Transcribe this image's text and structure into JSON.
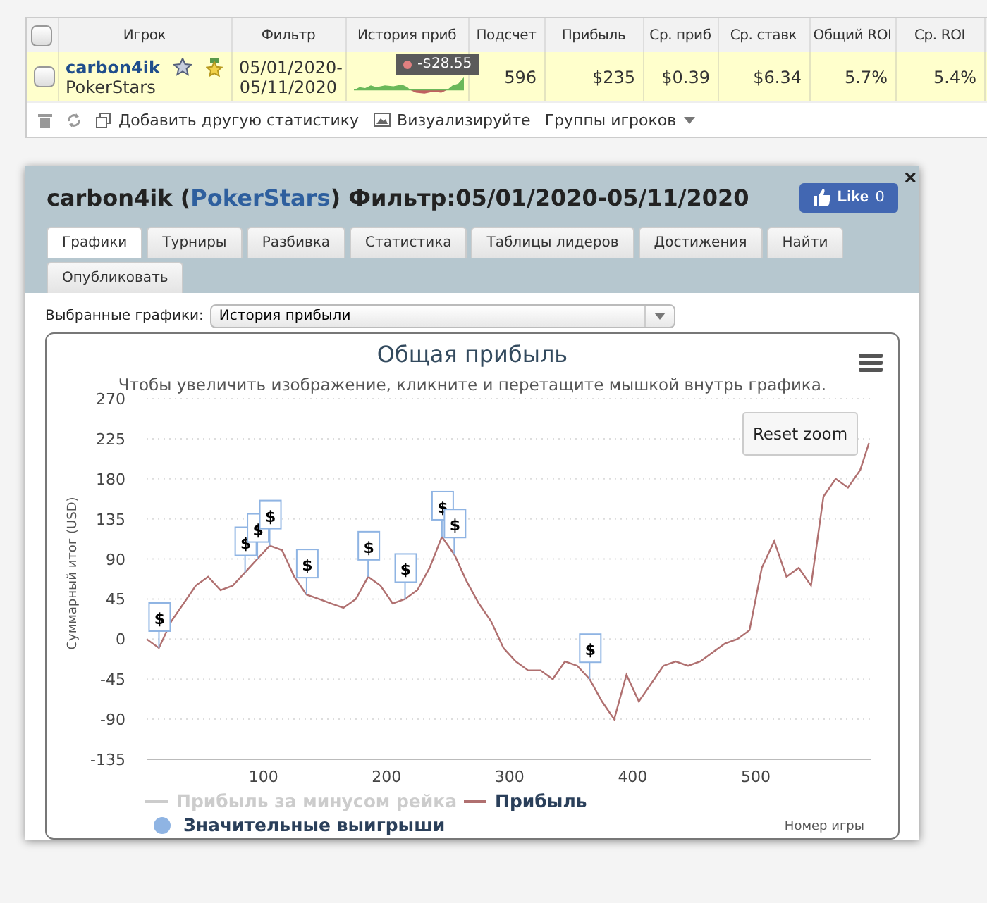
{
  "players_table": {
    "columns": [
      "Игрок",
      "Фильтр",
      "История приб",
      "Подсчет",
      "Прибыль",
      "Ср. приб",
      "Ср. ставк",
      "Общий ROI",
      "Ср. ROI"
    ],
    "header_checked": false,
    "rows": [
      {
        "checked": false,
        "player": "carbon4ik",
        "site": "PokerStars",
        "filter_from": "05/01/2020-",
        "filter_to": "05/11/2020",
        "count": "596",
        "profit": "$235",
        "avg_profit": "$0.39",
        "avg_stake": "$6.34",
        "total_roi": "5.7%",
        "avg_roi": "5.4%"
      }
    ],
    "tooltip": "-$28.55",
    "toolbar": [
      {
        "kind": "delete"
      },
      {
        "kind": "refresh"
      },
      {
        "kind": "add",
        "label": "Добавить другую статистику"
      },
      {
        "kind": "image",
        "label": "Визуализируйте"
      },
      {
        "kind": "dropdown",
        "label": "Группы игроков"
      }
    ]
  },
  "panel": {
    "title_before": "carbon4ik (",
    "site": "PokerStars",
    "title_after": ") Фильтр:05/01/2020-05/11/2020",
    "like": {
      "label": "Like",
      "count": "0"
    },
    "close": "×",
    "tabs": [
      {
        "label": "Графики",
        "selected": true
      },
      {
        "label": "Турниры",
        "selected": false
      },
      {
        "label": "Разбивка",
        "selected": false
      },
      {
        "label": "Статистика",
        "selected": false
      },
      {
        "label": "Таблицы лидеров",
        "selected": false
      },
      {
        "label": "Достижения",
        "selected": false
      },
      {
        "label": "Найти",
        "selected": false
      },
      {
        "label": "Опубликовать",
        "selected": false
      }
    ],
    "chart_select": {
      "label": "Выбранные графики:",
      "value": "История прибыли"
    },
    "chart": {
      "reset_zoom": "Reset zoom",
      "subtitle": "Чтобы увеличить изображение, кликните и перетащите мышкой внутрь графика.",
      "legend": [
        {
          "label": "Прибыль за минусом рейка",
          "visible": false,
          "kind": "line",
          "color": "#cccccc"
        },
        {
          "visible": true,
          "kind": "series",
          "color": "#b07070"
        },
        {
          "label": "Значительные выигрыши",
          "visible": true,
          "kind": "dot",
          "color": "#8fb4e3"
        }
      ],
      "chart_data": {
        "type": "line",
        "title": "Общая прибыль",
        "xlabel": "Номер игры",
        "ylabel": "Суммарный итог (USD)",
        "xlim": [
          5,
          594
        ],
        "ylim": [
          -135,
          270
        ],
        "grid": true,
        "xticks": [
          100,
          200,
          300,
          400,
          500
        ],
        "yticks": [
          -135,
          -90,
          -45,
          0,
          45,
          90,
          135,
          180,
          225,
          270
        ],
        "x": [
          5,
          15,
          25,
          35,
          45,
          55,
          65,
          75,
          85,
          95,
          105,
          115,
          125,
          135,
          145,
          155,
          165,
          175,
          185,
          195,
          205,
          215,
          225,
          235,
          245,
          255,
          265,
          275,
          285,
          295,
          305,
          315,
          325,
          335,
          345,
          355,
          365,
          375,
          385,
          395,
          405,
          415,
          425,
          435,
          445,
          455,
          465,
          475,
          485,
          495,
          505,
          515,
          525,
          535,
          545,
          555,
          565,
          575,
          585,
          592
        ],
        "series": [
          {
            "name": "Прибыль",
            "color": "#b07070",
            "values": [
              0,
              -10,
              20,
              40,
              60,
              70,
              55,
              60,
              75,
              90,
              105,
              100,
              70,
              50,
              45,
              40,
              35,
              45,
              70,
              60,
              40,
              45,
              55,
              80,
              115,
              95,
              65,
              40,
              20,
              -10,
              -25,
              -35,
              -35,
              -45,
              -25,
              -30,
              -45,
              -70,
              -90,
              -40,
              -70,
              -50,
              -30,
              -25,
              -30,
              -25,
              -15,
              -5,
              0,
              10,
              80,
              110,
              70,
              80,
              60,
              160,
              180,
              170,
              190,
              220
            ]
          }
        ],
        "annotations": [
          {
            "x": 15,
            "text": "$"
          },
          {
            "x": 85,
            "text": "$"
          },
          {
            "x": 95,
            "text": "$"
          },
          {
            "x": 105,
            "text": "$"
          },
          {
            "x": 135,
            "text": "$"
          },
          {
            "x": 185,
            "text": "$"
          },
          {
            "x": 215,
            "text": "$"
          },
          {
            "x": 245,
            "text": "$"
          },
          {
            "x": 255,
            "text": "$"
          },
          {
            "x": 365,
            "text": "$"
          }
        ]
      }
    }
  }
}
